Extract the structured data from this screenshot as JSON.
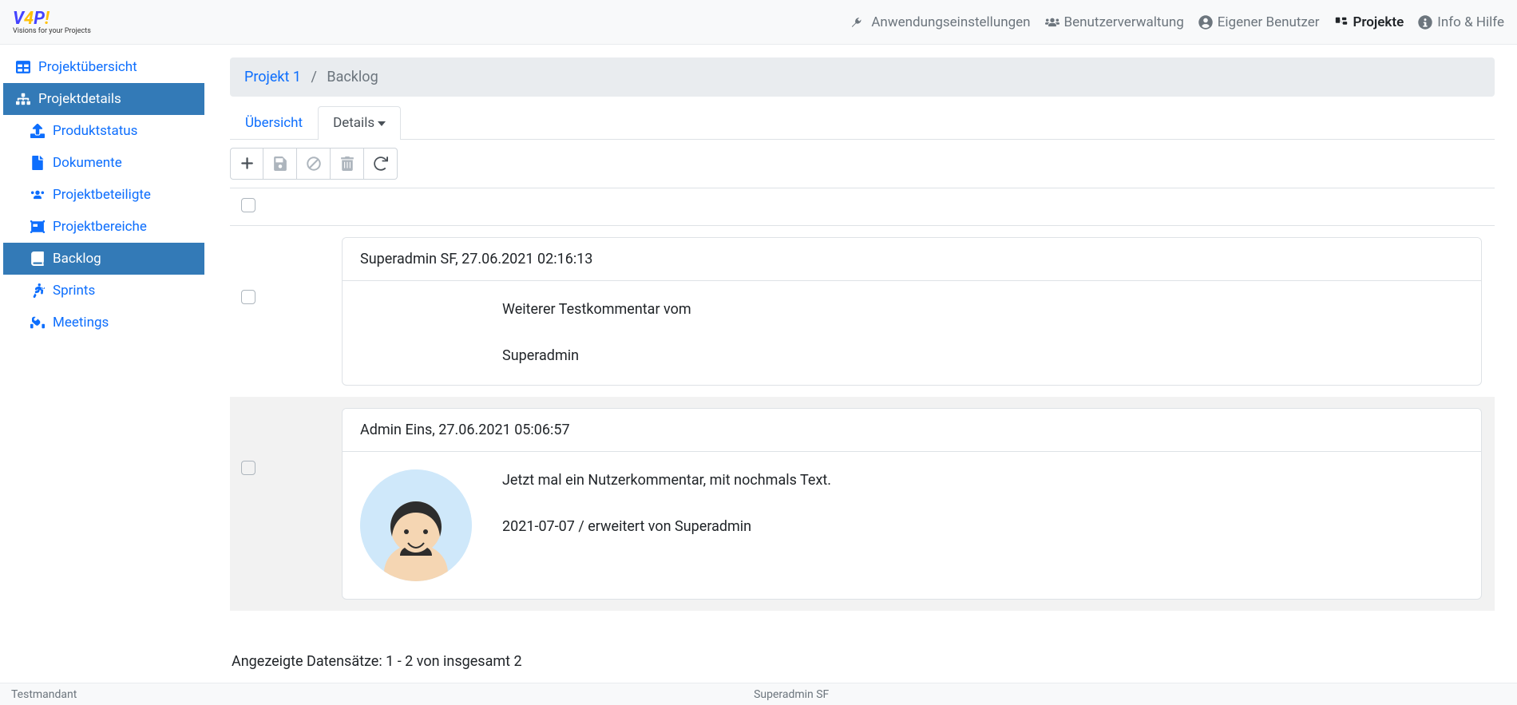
{
  "brand": {
    "tagline": "Visions for your Projects"
  },
  "topnav": {
    "settings": "Anwendungseinstellungen",
    "user_mgmt": "Benutzerverwaltung",
    "own_user": "Eigener Benutzer",
    "projects": "Projekte",
    "info_help": "Info & Hilfe"
  },
  "sidebar": {
    "overview": "Projektübersicht",
    "details": "Projektdetails",
    "product_status": "Produktstatus",
    "documents": "Dokumente",
    "participants": "Projektbeteiligte",
    "project_areas": "Projektbereiche",
    "backlog": "Backlog",
    "sprints": "Sprints",
    "meetings": "Meetings"
  },
  "breadcrumb": {
    "project": "Projekt 1",
    "page": "Backlog"
  },
  "tabs": {
    "overview": "Übersicht",
    "details": "Details"
  },
  "rows": [
    {
      "header": "Superadmin SF, 27.06.2021 02:16:13",
      "text": "Weiterer Testkommentar vom\n\nSuperadmin",
      "has_avatar": false
    },
    {
      "header": "Admin Eins, 27.06.2021 05:06:57",
      "text": "Jetzt mal ein Nutzerkommentar, mit nochmals Text.\n\n2021-07-07 / erweitert von Superadmin",
      "has_avatar": true
    }
  ],
  "counter": "Angezeigte Datensätze: 1 - 2 von insgesamt 2",
  "status": {
    "left": "Testmandant",
    "center": "Superadmin SF"
  }
}
